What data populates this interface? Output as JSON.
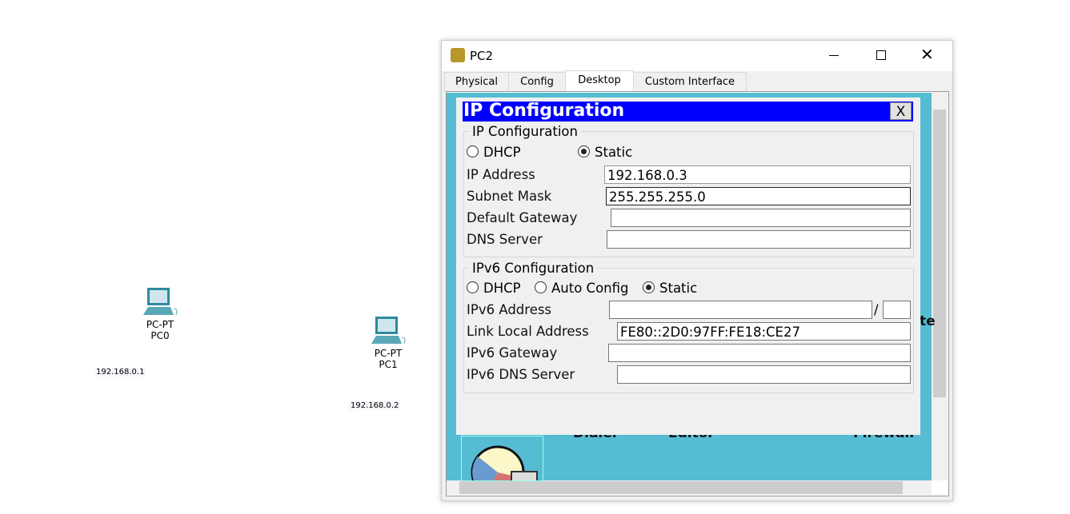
{
  "workspace": {
    "devices": [
      {
        "type": "PC-PT",
        "name": "PC0",
        "ip": "192.168.0.1"
      },
      {
        "type": "PC-PT",
        "name": "PC1",
        "ip": "192.168.0.2"
      }
    ]
  },
  "window": {
    "title": "PC2",
    "tabs": [
      "Physical",
      "Config",
      "Desktop",
      "Custom Interface"
    ],
    "active_tab": "Desktop"
  },
  "desktop_bg": {
    "apps": [
      "Dialer",
      "Editor",
      "Firewall"
    ],
    "partial": "te"
  },
  "dialog": {
    "title": "IP Configuration",
    "close": "X",
    "ipv4": {
      "legend": "IP Configuration",
      "dhcp": "DHCP",
      "static": "Static",
      "mode": "Static",
      "ip_label": "IP Address",
      "ip": "192.168.0.3",
      "mask_label": "Subnet Mask",
      "mask": "255.255.255.0",
      "gw_label": "Default Gateway",
      "gw": "",
      "dns_label": "DNS Server",
      "dns": ""
    },
    "ipv6": {
      "legend": "IPv6 Configuration",
      "dhcp": "DHCP",
      "auto": "Auto Config",
      "static": "Static",
      "mode": "Static",
      "addr_label": "IPv6 Address",
      "addr": "",
      "slash": "/",
      "prefix": "",
      "ll_label": "Link Local Address",
      "ll": "FE80::2D0:97FF:FE18:CE27",
      "gw_label": "IPv6 Gateway",
      "gw": "",
      "dns_label": "IPv6 DNS Server",
      "dns": ""
    }
  },
  "colors": {
    "dialog_title": "#0000ff",
    "desktop": "#55bcd4"
  }
}
